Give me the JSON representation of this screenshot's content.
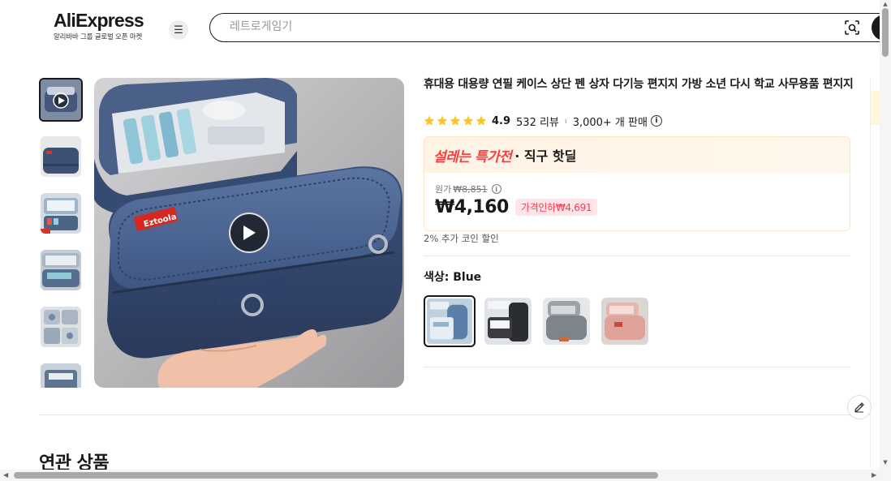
{
  "header": {
    "logo": "AliExpress",
    "logo_tagline": "알리바바 그룹 글로벌 오픈 마켓",
    "menu_icon": "hamburger-icon",
    "search_placeholder": "레트로게임기",
    "camera_icon": "camera-search-icon"
  },
  "gallery": {
    "thumbnails": [
      "video-thumb",
      "bag-top-view",
      "bag-open-contents",
      "bag-open-side",
      "bag-compartments",
      "bag-stacked"
    ],
    "main_image": "blue-pencil-case",
    "play_icon": "play-icon"
  },
  "product": {
    "title": "휴대용 대용량 연필 케이스 상단 펜 상자 다기능 편지지 가방 소년 다시 학교 사무용품 편지지",
    "rating": "4.9",
    "reviews": "532 리뷰",
    "separator": "ı",
    "sold": "3,000+ 개 판매",
    "info_glyph": "i"
  },
  "deal": {
    "brand": "설레는 특가전",
    "subtitle": "· 직구 핫딜",
    "original_label": "원가",
    "original_price": "₩8,851",
    "price": "₩4,160",
    "discount": "가격인하₩4,691",
    "coin": "2% 추가 코인 할인"
  },
  "color": {
    "label": "색상: Blue",
    "options": [
      "Blue",
      "Black",
      "Gray",
      "Pink"
    ],
    "selected": "Blue"
  },
  "related": {
    "title": "연관 상품"
  },
  "scroll": {
    "up": "▲",
    "down": "▼",
    "left": "◀",
    "right": "▶"
  }
}
